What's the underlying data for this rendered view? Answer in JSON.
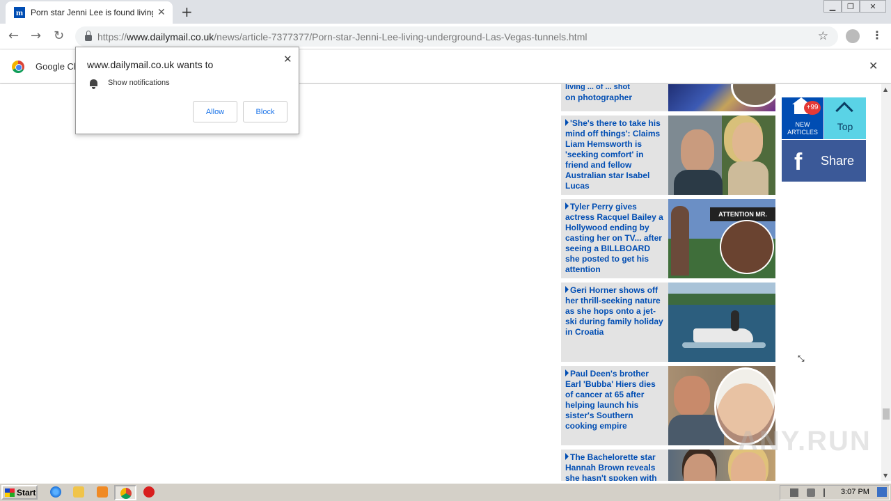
{
  "browser": {
    "tab_title": "Porn star Jenni Lee is found living in",
    "tab_favicon": "m",
    "new_tab": "+",
    "url_scheme": "https://",
    "url_host": "www.dailymail.co.uk",
    "url_path": "/news/article-7377377/Porn-star-Jenni-Lee-living-underground-Las-Vegas-tunnels.html"
  },
  "infobar": {
    "text": "Google Ch"
  },
  "popup": {
    "title": "www.dailymail.co.uk wants to",
    "permission": "Show notifications",
    "allow": "Allow",
    "block": "Block"
  },
  "articles": [
    {
      "text": "on photographer",
      "partial_top": "living ... of ... shot"
    },
    {
      "text": "'She's there to take his mind off things': Claims Liam Hemsworth is 'seeking comfort' in friend and fellow Australian star Isabel Lucas"
    },
    {
      "text": "Tyler Perry gives actress Racquel Bailey a Hollywood ending by casting her on TV... after seeing a BILLBOARD she posted to get his attention",
      "img_caption": "ATTENTION MR. PERRY"
    },
    {
      "text": "Geri Horner shows off her thrill-seeking nature as she hops onto a jet-ski during family holiday in Croatia"
    },
    {
      "text": "Paul Deen's brother Earl 'Bubba' Hiers dies of cancer at 65 after helping launch his sister's Southern cooking empire"
    },
    {
      "text": "The Bachelorette star Hannah Brown reveals she hasn't spoken with"
    }
  ],
  "widgets": {
    "badge": "+99",
    "new_articles_line1": "NEW",
    "new_articles_line2": "ARTICLES",
    "top": "Top",
    "share": "Share",
    "fb_icon": "f"
  },
  "watermark": "ANY.RUN",
  "taskbar": {
    "start": "Start",
    "clock": "3:07 PM"
  },
  "colors": {
    "dailymail_blue": "#004db3",
    "facebook_blue": "#3b5998",
    "top_cyan": "#5ad3e6"
  }
}
